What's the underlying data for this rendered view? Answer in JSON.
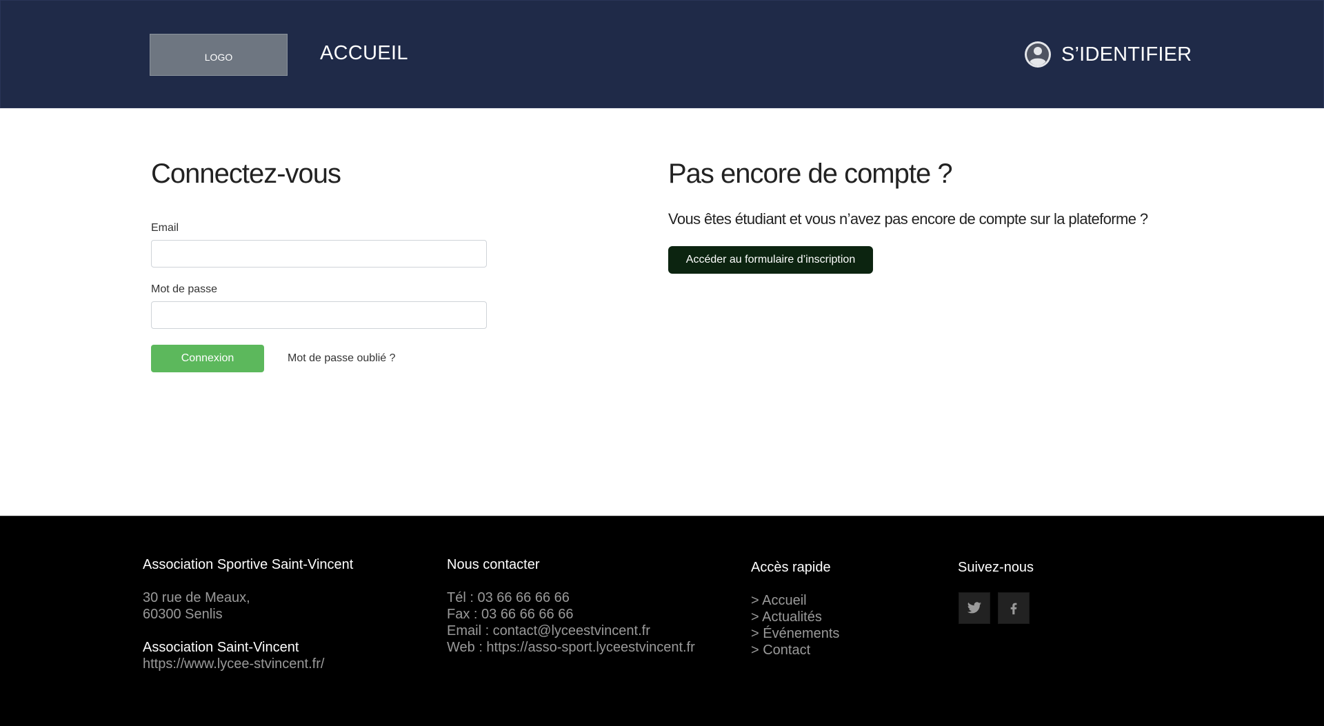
{
  "header": {
    "logo_text": "LOGO",
    "nav_home": "ACCUEIL",
    "login_label": "S’IDENTIFIER",
    "background": "#1f2a48"
  },
  "login": {
    "title": "Connectez-vous",
    "email_label": "Email",
    "email_value": "",
    "password_label": "Mot de passe",
    "password_value": "",
    "submit_label": "Connexion",
    "forgot_label": "Mot de passe oublié ?",
    "submit_color": "#5cb85c"
  },
  "register": {
    "title": "Pas encore de compte ?",
    "text": "Vous êtes étudiant et vous n’avez pas encore de compte sur la plateforme ?",
    "button_label": "Accéder au formulaire d’inscription",
    "button_color": "#0c2410"
  },
  "footer": {
    "association": {
      "heading": "Association Sportive Saint-Vincent",
      "address_line1": "30 rue de Meaux,",
      "address_line2": "60300 Senlis",
      "site_name": "Association Saint-Vincent",
      "site_url": "https://www.lycee-stvincent.fr/"
    },
    "contact": {
      "heading": "Nous contacter",
      "phone": "Tél : 03 66 66 66 66",
      "fax": "Fax : 03 66 66 66 66",
      "email": "Email : contact@lyceestvincent.fr",
      "web": "Web : https://asso-sport.lyceestvincent.fr"
    },
    "quick_access": {
      "heading": "Accès rapide",
      "links": [
        "> Accueil",
        "> Actualités",
        "> Événements",
        "> Contact"
      ]
    },
    "follow": {
      "heading": "Suivez-nous",
      "icons": [
        "twitter-icon",
        "facebook-icon"
      ]
    }
  }
}
